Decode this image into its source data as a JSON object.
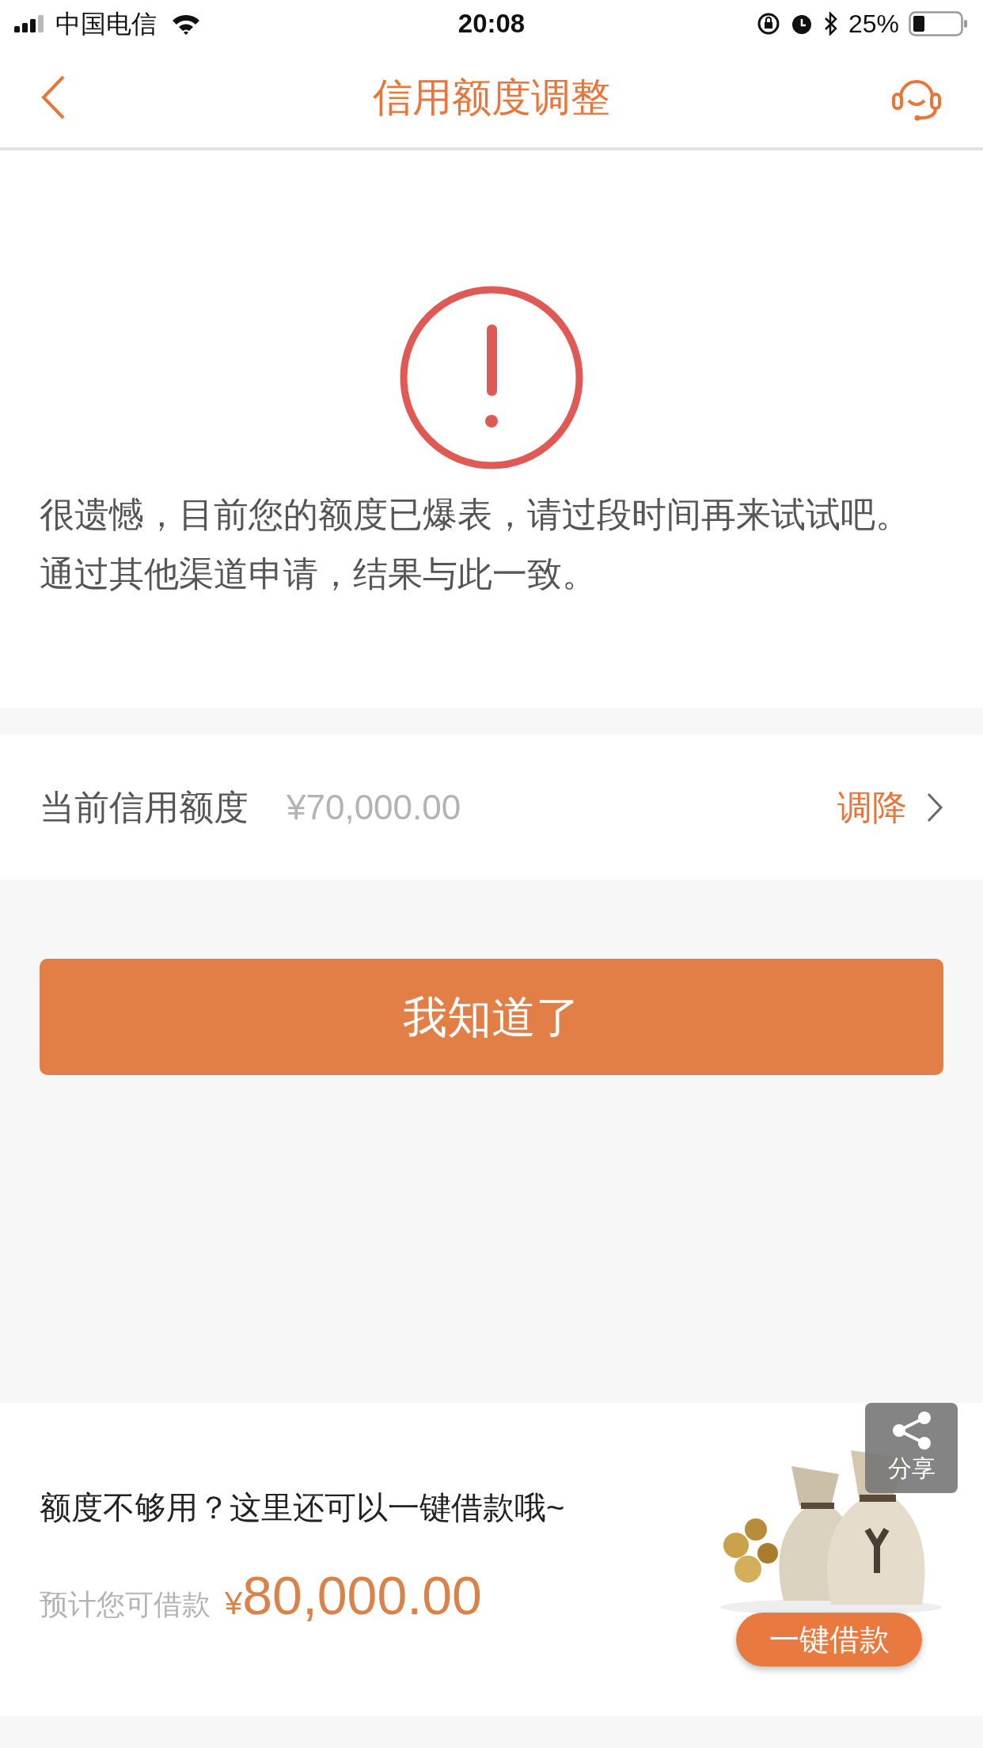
{
  "status_bar": {
    "carrier": "中国电信",
    "time": "20:08",
    "battery": "25%"
  },
  "nav": {
    "title": "信用额度调整"
  },
  "message": "很遗憾，目前您的额度已爆表，请过段时间再来试试吧。通过其他渠道申请，结果与此一致。",
  "credit_row": {
    "label": "当前信用额度",
    "amount": "¥70,000.00",
    "action": "调降"
  },
  "confirm_button": "我知道了",
  "promo": {
    "headline": "额度不够用？这里还可以一键借款哦~",
    "estimate_label": "预计您可借款",
    "currency": "¥",
    "amount": "80,000.00",
    "button": "一键借款",
    "share": "分享"
  }
}
